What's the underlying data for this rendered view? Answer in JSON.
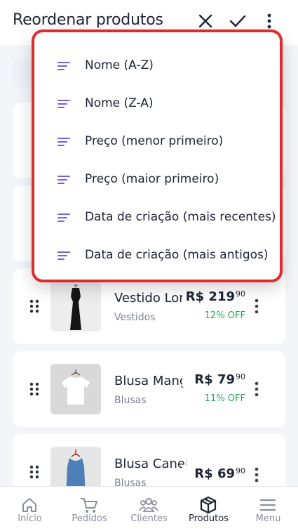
{
  "header": {
    "title": "Reordenar produtos",
    "close_icon": "close-icon",
    "confirm_icon": "check-icon",
    "more_icon": "more-vertical-icon"
  },
  "sort_menu": {
    "accent": "#7b5ce6",
    "highlight_border": "#e02b2b",
    "items": [
      {
        "label": "Nome (A-Z)",
        "icon": "sort-lines-icon"
      },
      {
        "label": "Nome (Z-A)",
        "icon": "sort-lines-icon"
      },
      {
        "label": "Preço (menor primeiro)",
        "icon": "sort-lines-icon"
      },
      {
        "label": "Preço (maior primeiro)",
        "icon": "sort-lines-icon"
      },
      {
        "label": "Data de criação (mais recentes)",
        "icon": "sort-lines-icon"
      },
      {
        "label": "Data de criação (mais antigos)",
        "icon": "sort-lines-icon"
      }
    ]
  },
  "products": [
    {
      "name": "Vestido Lor",
      "category": "Vestidos",
      "price_main": "R$ 219",
      "price_cents": "90",
      "discount": "12% OFF"
    },
    {
      "name": "Blusa Manga",
      "category": "Blusas",
      "price_main": "R$ 79",
      "price_cents": "90",
      "discount": "11% OFF"
    },
    {
      "name": "Blusa Canela",
      "category": "Blusas",
      "price_main": "R$ 69",
      "price_cents": "90",
      "discount": ""
    }
  ],
  "bottom_nav": {
    "items": [
      {
        "label": "Início",
        "icon": "home-icon"
      },
      {
        "label": "Pedidos",
        "icon": "cart-icon"
      },
      {
        "label": "Clientes",
        "icon": "users-icon"
      },
      {
        "label": "Produtos",
        "icon": "box-icon",
        "active": true
      },
      {
        "label": "Menu",
        "icon": "hamburger-icon"
      }
    ]
  },
  "colors": {
    "discount": "#26a65b",
    "text": "#1d2433",
    "muted": "#7c8192"
  }
}
